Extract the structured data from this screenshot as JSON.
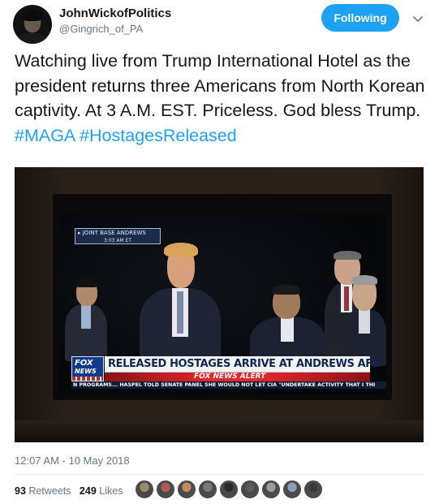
{
  "user": {
    "display_name": "JohnWickofPolitics",
    "screen_name": "@Gingrich_of_PA",
    "avatar_icon": "user-avatar"
  },
  "follow_button": {
    "label": "Following",
    "color": "#1da1f2"
  },
  "caret_icon": "chevron-down-icon",
  "tweet": {
    "text_1": "Watching live from Trump International Hotel as the president returns three Americans from North Korean captivity. At 3 A.M. EST. Priceless. God bless Trump.",
    "hashtag_1": "#MAGA",
    "hashtag_2": "#HostagesReleased",
    "link_color": "#1da1f2"
  },
  "media": {
    "location_line_1": "▸ JOINT BASE ANDREWS",
    "location_line_2": "3:03 AM ET",
    "logo_top": "FOX",
    "logo_bottom": "NEWS",
    "headline": "RELEASED HOSTAGES ARRIVE AT ANDREWS AFB",
    "alert": "FOX NEWS ALERT",
    "ticker": "N PROGRAMS... HASPEL TOLD SENATE PANEL SHE WOULD NOT LET CIA \"UNDERTAKE ACTIVITY THAT I THI"
  },
  "timestamp": "12:07 AM - 10 May 2018",
  "stats": {
    "retweets_count": "93",
    "retweets_label": "Retweets",
    "likes_count": "249",
    "likes_label": "Likes"
  },
  "liker_avatars": [
    {
      "name": "liker-avatar-1",
      "color": "#9a8a6a"
    },
    {
      "name": "liker-avatar-2",
      "color": "#b05a5a"
    },
    {
      "name": "liker-avatar-3",
      "color": "#c88a5a"
    },
    {
      "name": "liker-avatar-4",
      "color": "#7a7a7a"
    },
    {
      "name": "liker-avatar-5",
      "color": "#2a2a2a"
    },
    {
      "name": "liker-avatar-6",
      "color": "#5a5a5a"
    },
    {
      "name": "liker-avatar-7",
      "color": "#a09aa0"
    },
    {
      "name": "liker-avatar-8",
      "color": "#8aa0b8"
    },
    {
      "name": "liker-avatar-9",
      "color": "#3a3a3a"
    }
  ]
}
